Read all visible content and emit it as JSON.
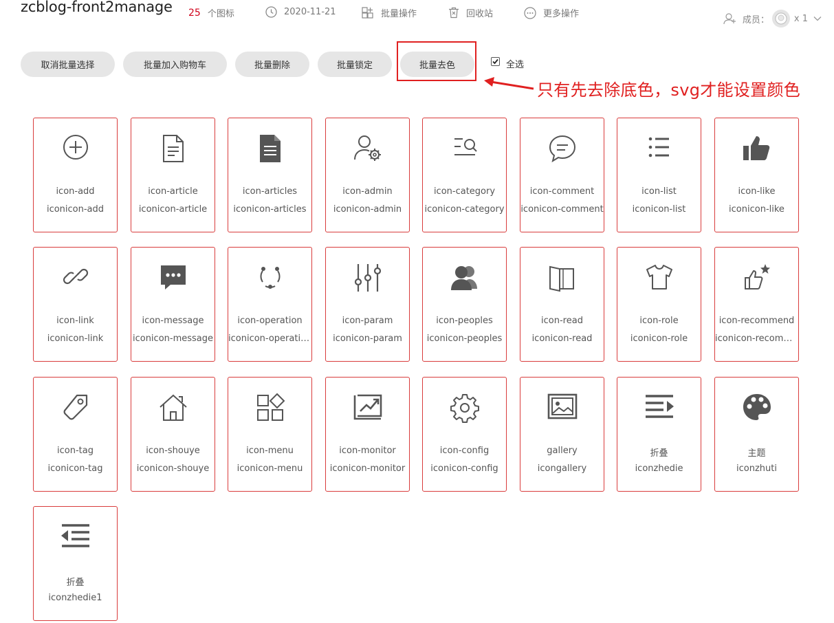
{
  "header": {
    "title": "zcblog-front2manage",
    "icon_count": "25",
    "icon_count_label": "个图标",
    "date": "2020-11-21",
    "batch_ops": "批量操作",
    "recycle": "回收站",
    "more_ops": "更多操作",
    "members_label": "成员：",
    "members_count": "x 1"
  },
  "toolbar": {
    "cancel_batch": "取消批量选择",
    "add_cart": "批量加入购物车",
    "batch_delete": "批量删除",
    "batch_lock": "批量锁定",
    "batch_decolor": "批量去色",
    "select_all": "全选",
    "select_all_checked": true
  },
  "annotation": "只有先去除底色，svg才能设置颜色",
  "accent_color": "#e02020",
  "icons": [
    {
      "name": "icon-add",
      "cls": "iconicon-add",
      "glyph": "add-icon"
    },
    {
      "name": "icon-article",
      "cls": "iconicon-article",
      "glyph": "article-icon"
    },
    {
      "name": "icon-articles",
      "cls": "iconicon-articles",
      "glyph": "articles-icon"
    },
    {
      "name": "icon-admin",
      "cls": "iconicon-admin",
      "glyph": "admin-icon"
    },
    {
      "name": "icon-category",
      "cls": "iconicon-category",
      "glyph": "category-icon"
    },
    {
      "name": "icon-comment",
      "cls": "iconicon-comment",
      "glyph": "comment-icon"
    },
    {
      "name": "icon-list",
      "cls": "iconicon-list",
      "glyph": "list-icon"
    },
    {
      "name": "icon-like",
      "cls": "iconicon-like",
      "glyph": "like-icon"
    },
    {
      "name": "icon-link",
      "cls": "iconicon-link",
      "glyph": "link-icon"
    },
    {
      "name": "icon-message",
      "cls": "iconicon-message",
      "glyph": "message-icon"
    },
    {
      "name": "icon-operation",
      "cls": "iconicon-operation",
      "glyph": "operation-icon"
    },
    {
      "name": "icon-param",
      "cls": "iconicon-param",
      "glyph": "param-icon"
    },
    {
      "name": "icon-peoples",
      "cls": "iconicon-peoples",
      "glyph": "peoples-icon"
    },
    {
      "name": "icon-read",
      "cls": "iconicon-read",
      "glyph": "read-icon"
    },
    {
      "name": "icon-role",
      "cls": "iconicon-role",
      "glyph": "role-icon"
    },
    {
      "name": "icon-recommend",
      "cls": "iconicon-recommend",
      "glyph": "recommend-icon"
    },
    {
      "name": "icon-tag",
      "cls": "iconicon-tag",
      "glyph": "tag-icon"
    },
    {
      "name": "icon-shouye",
      "cls": "iconicon-shouye",
      "glyph": "home-icon"
    },
    {
      "name": "icon-menu",
      "cls": "iconicon-menu",
      "glyph": "menu-icon"
    },
    {
      "name": "icon-monitor",
      "cls": "iconicon-monitor",
      "glyph": "monitor-icon"
    },
    {
      "name": "icon-config",
      "cls": "iconicon-config",
      "glyph": "config-icon"
    },
    {
      "name": "gallery",
      "cls": "icongallery",
      "glyph": "gallery-icon"
    },
    {
      "name": "折叠",
      "cls": "iconzhedie",
      "glyph": "fold-icon"
    },
    {
      "name": "主题",
      "cls": "iconzhuti",
      "glyph": "theme-icon"
    },
    {
      "name": "折叠",
      "cls": "iconzhedie1",
      "glyph": "unfold-icon"
    }
  ]
}
